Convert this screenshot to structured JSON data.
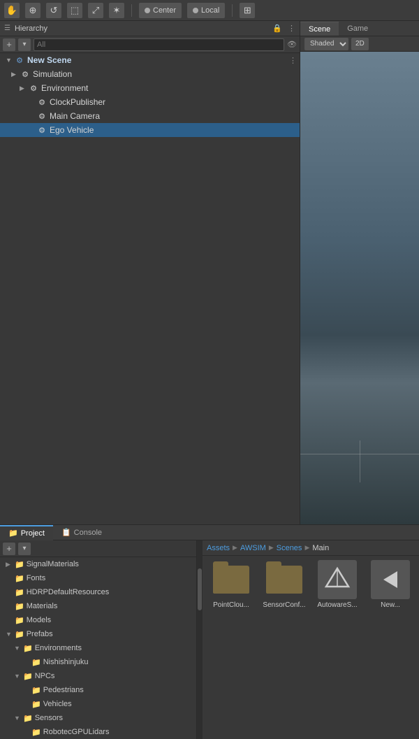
{
  "toolbar": {
    "icons": [
      "✋",
      "⊕",
      "↺",
      "⬚",
      "⤢",
      "↔",
      "✶"
    ],
    "center_label": "Center",
    "local_label": "Local",
    "pivot_icon": "⊞"
  },
  "hierarchy": {
    "panel_title": "Hierarchy",
    "search_placeholder": "All",
    "scene_name": "New Scene",
    "items": [
      {
        "id": "simulation",
        "label": "Simulation",
        "indent": 1,
        "arrow": "▶",
        "icon": "⚙"
      },
      {
        "id": "environment",
        "label": "Environment",
        "indent": 2,
        "arrow": "▶",
        "icon": "⚙"
      },
      {
        "id": "clockpublisher",
        "label": "ClockPublisher",
        "indent": 3,
        "arrow": "",
        "icon": "⚙"
      },
      {
        "id": "maincamera",
        "label": "Main Camera",
        "indent": 3,
        "arrow": "",
        "icon": "⚙"
      },
      {
        "id": "egovehicle",
        "label": "Ego Vehicle",
        "indent": 3,
        "arrow": "",
        "icon": "⚙"
      }
    ]
  },
  "scene": {
    "tab_scene": "Scene",
    "tab_game": "Game",
    "shaded_label": "Shaded",
    "twod_label": "2D"
  },
  "bottom": {
    "tab_project": "Project",
    "tab_console": "Console",
    "add_label": "+",
    "breadcrumb": [
      "Assets",
      "AWSIM",
      "Scenes",
      "Main"
    ],
    "folders": [
      {
        "id": "signalmaterials",
        "label": "SignalMaterials",
        "indent": 0,
        "arrow": "▶"
      },
      {
        "id": "fonts",
        "label": "Fonts",
        "indent": 0,
        "arrow": ""
      },
      {
        "id": "hdrpdefaultresources",
        "label": "HDRPDefaultResources",
        "indent": 0,
        "arrow": ""
      },
      {
        "id": "materials",
        "label": "Materials",
        "indent": 0,
        "arrow": ""
      },
      {
        "id": "models",
        "label": "Models",
        "indent": 0,
        "arrow": ""
      },
      {
        "id": "prefabs",
        "label": "Prefabs",
        "indent": 0,
        "arrow": "▼"
      },
      {
        "id": "environments",
        "label": "Environments",
        "indent": 1,
        "arrow": "▼"
      },
      {
        "id": "nishinjuku",
        "label": "Nishishinjuku",
        "indent": 2,
        "arrow": ""
      },
      {
        "id": "npcs",
        "label": "NPCs",
        "indent": 1,
        "arrow": "▼"
      },
      {
        "id": "pedestrians",
        "label": "Pedestrians",
        "indent": 2,
        "arrow": ""
      },
      {
        "id": "vehicles",
        "label": "Vehicles",
        "indent": 2,
        "arrow": ""
      },
      {
        "id": "sensors",
        "label": "Sensors",
        "indent": 1,
        "arrow": "▼"
      },
      {
        "id": "robotecgpulidars",
        "label": "RobotecGPULidars",
        "indent": 2,
        "arrow": ""
      }
    ],
    "assets": [
      {
        "id": "pointclo",
        "label": "PointClou...",
        "type": "folder"
      },
      {
        "id": "sensorconf",
        "label": "SensorConf...",
        "type": "folder"
      },
      {
        "id": "autowares",
        "label": "AutowareS...",
        "type": "unity"
      },
      {
        "id": "new",
        "label": "New...",
        "type": "arrow"
      }
    ]
  }
}
